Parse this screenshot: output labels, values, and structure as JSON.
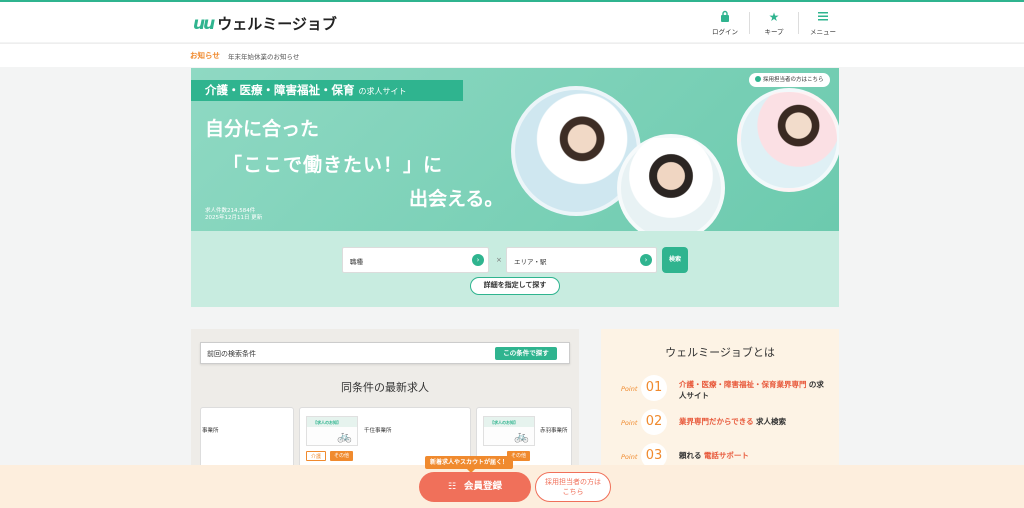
{
  "header": {
    "logo_mark": "uu",
    "logo_text": "ウェルミージョブ",
    "login_label": "ログイン",
    "keep_label": "キープ",
    "menu_label": "メニュー"
  },
  "notice": {
    "label": "お知らせ",
    "text": "年末年始休業のお知らせ"
  },
  "hero": {
    "band_main": "介護・医療・障害福祉・保育",
    "band_small": "の求人サイト",
    "line1": "自分に合った",
    "line2": "「ここで働きたい！」に",
    "line3": "出会える。",
    "stats_count": "求人件数214,584件",
    "stats_date": "2025年12月11日 更新",
    "employer_link": "採用担当者の方はこちら"
  },
  "search": {
    "job_type": "職種",
    "area": "エリア・駅",
    "times": "×",
    "search_button": "検索",
    "detail_button": "詳細を指定して探す"
  },
  "recent": {
    "condition_label": "前回の検索条件",
    "condition_button": "この条件で探す",
    "title": "同条件の最新求人",
    "jobs": [
      {
        "name": "事業所"
      },
      {
        "name": "千住事業所",
        "thumb_tag": "【求人のお知】",
        "chip1": "介護",
        "chip2": "その他"
      },
      {
        "name": "赤羽事業所",
        "thumb_tag": "【求人のお知】",
        "chip2": "その他"
      }
    ]
  },
  "about": {
    "title": "ウェルミージョブとは",
    "point_word": "Point",
    "points": [
      {
        "num": "01",
        "hl": "介護・医療・障害福祉・保育業界専門",
        "rest": "の求人サイト"
      },
      {
        "num": "02",
        "hl": "業界専門だからできる",
        "rest": "求人検索"
      },
      {
        "num": "03",
        "pre": "頼れる",
        "hl": "電話サポート"
      }
    ]
  },
  "footer": {
    "promo": "新着求人やスカウトが届く！",
    "register": "会員登録",
    "employer_line1": "採用担当者の方は",
    "employer_line2": "こちら"
  },
  "colors": {
    "brand": "#2fb48f",
    "accent": "#f08a2e",
    "cta": "#f0705a"
  }
}
